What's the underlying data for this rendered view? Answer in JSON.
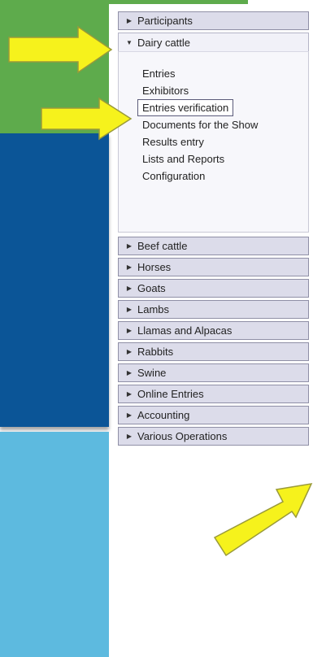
{
  "colors": {
    "green": "#5eab4c",
    "navy": "#0b5597",
    "sky": "#5dbadf",
    "arrow_fill": "#f6f21c",
    "arrow_stroke": "#9a9a3a"
  },
  "menu": {
    "sections": [
      {
        "label": "Participants",
        "expanded": false
      },
      {
        "label": "Dairy cattle",
        "expanded": true,
        "items": [
          "Entries",
          "Exhibitors",
          "Entries verification",
          "Documents for the Show",
          "Results entry",
          "Lists and Reports",
          "Configuration"
        ],
        "selected_item": "Entries verification"
      },
      {
        "label": "Beef cattle",
        "expanded": false
      },
      {
        "label": "Horses",
        "expanded": false
      },
      {
        "label": "Goats",
        "expanded": false
      },
      {
        "label": "Lambs",
        "expanded": false
      },
      {
        "label": "Llamas and Alpacas",
        "expanded": false
      },
      {
        "label": "Rabbits",
        "expanded": false
      },
      {
        "label": "Swine",
        "expanded": false
      },
      {
        "label": "Online Entries",
        "expanded": false
      },
      {
        "label": "Accounting",
        "expanded": false
      },
      {
        "label": "Various Operations",
        "expanded": false
      }
    ],
    "icons": {
      "collapsed": "triangle-right-icon",
      "expanded": "triangle-down-icon"
    }
  }
}
